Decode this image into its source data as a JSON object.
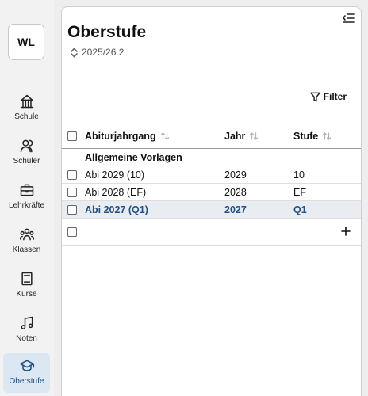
{
  "user": {
    "initials": "WL"
  },
  "sidebar": {
    "items": [
      {
        "label": "Schule"
      },
      {
        "label": "Schüler"
      },
      {
        "label": "Lehrkräfte"
      },
      {
        "label": "Klassen"
      },
      {
        "label": "Kurse"
      },
      {
        "label": "Noten"
      },
      {
        "label": "Oberstufe"
      }
    ],
    "active_index": 6
  },
  "main": {
    "title": "Oberstufe",
    "term": "2025/26.2",
    "filter_label": "Filter"
  },
  "table": {
    "columns": [
      "Abiturjahrgang",
      "Jahr",
      "Stufe"
    ],
    "template_row": {
      "name": "Allgemeine Vorlagen",
      "jahr": "—",
      "stufe": "—"
    },
    "rows": [
      {
        "name": "Abi 2029 (10)",
        "jahr": "2029",
        "stufe": "10"
      },
      {
        "name": "Abi 2028 (EF)",
        "jahr": "2028",
        "stufe": "EF"
      },
      {
        "name": "Abi 2027 (Q1)",
        "jahr": "2027",
        "stufe": "Q1"
      }
    ],
    "selected_index": 2
  },
  "colors": {
    "accent": "#1f5286",
    "selected_bg": "#e9ecf0",
    "nav_active_bg": "#dbe8f4"
  }
}
